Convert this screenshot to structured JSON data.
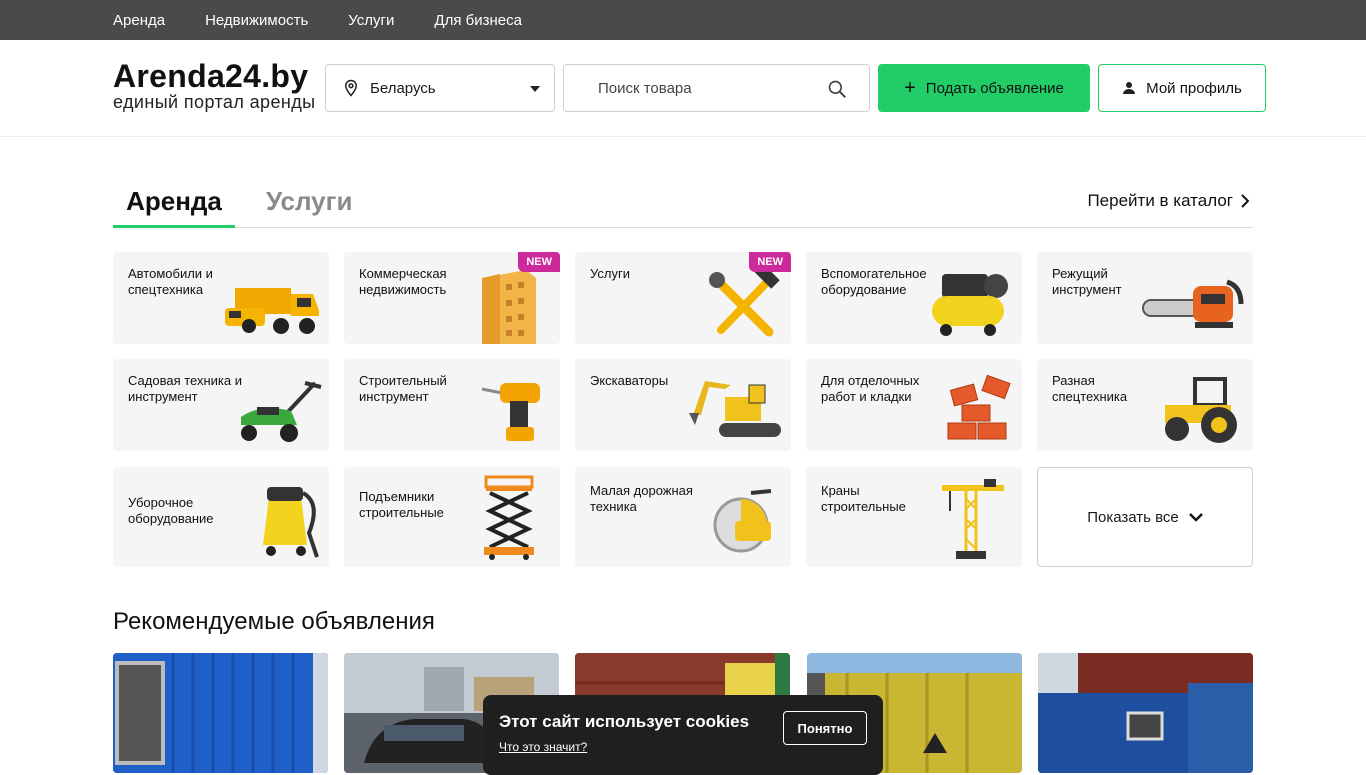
{
  "topnav": [
    "Аренда",
    "Недвижимость",
    "Услуги",
    "Для бизнеса"
  ],
  "header": {
    "logo_title": "Arenda24.by",
    "logo_subtitle": "единый портал аренды",
    "region": "Беларусь",
    "search_placeholder": "Поиск товара",
    "post_button": "Подать объявление",
    "profile_button": "Мой профиль"
  },
  "tabs": {
    "active": "Аренда",
    "inactive": "Услуги",
    "catalog_link": "Перейти в каталог"
  },
  "categories": [
    {
      "label": "Автомобили и спецтехника",
      "icon": "dump-truck-icon"
    },
    {
      "label": "Коммерческая недвижимость",
      "icon": "building-icon",
      "badge": "NEW"
    },
    {
      "label": "Услуги",
      "icon": "hammer-wrench-icon",
      "badge": "NEW"
    },
    {
      "label": "Вспомогательное оборудование",
      "icon": "compressor-icon"
    },
    {
      "label": "Режущий инструмент",
      "icon": "chainsaw-icon"
    },
    {
      "label": "Садовая техника и инструмент",
      "icon": "lawn-mower-icon"
    },
    {
      "label": "Строительный инструмент",
      "icon": "drill-icon"
    },
    {
      "label": "Экскаваторы",
      "icon": "excavator-icon"
    },
    {
      "label": "Для отделочных работ и кладки",
      "icon": "bricks-icon"
    },
    {
      "label": "Разная спецтехника",
      "icon": "tractor-icon"
    },
    {
      "label": "Уборочное оборудование",
      "icon": "vacuum-icon"
    },
    {
      "label": "Подъемники строительные",
      "icon": "scissor-lift-icon"
    },
    {
      "label": "Малая дорожная техника",
      "icon": "road-saw-icon"
    },
    {
      "label": "Краны строительные",
      "icon": "crane-icon"
    }
  ],
  "show_all": "Показать все",
  "recommended_title": "Рекомендуемые объявления",
  "listings": [
    {
      "image": "blue-container-photo",
      "color": "#1f5fc8"
    },
    {
      "image": "black-car-photo",
      "color": "#8a949e"
    },
    {
      "image": "red-containers-photo",
      "color": "#8a3a2a"
    },
    {
      "image": "yellow-container-photo",
      "color": "#c9b632"
    },
    {
      "image": "blue-cabin-photo",
      "color": "#1d4f9e"
    }
  ],
  "cookie": {
    "title": "Этот сайт использует cookies",
    "link": "Что это значит?",
    "button": "Понятно"
  },
  "colors": {
    "accent": "#22cc66",
    "topbar": "#4a4a4a",
    "badge": "#cc2a9a"
  }
}
